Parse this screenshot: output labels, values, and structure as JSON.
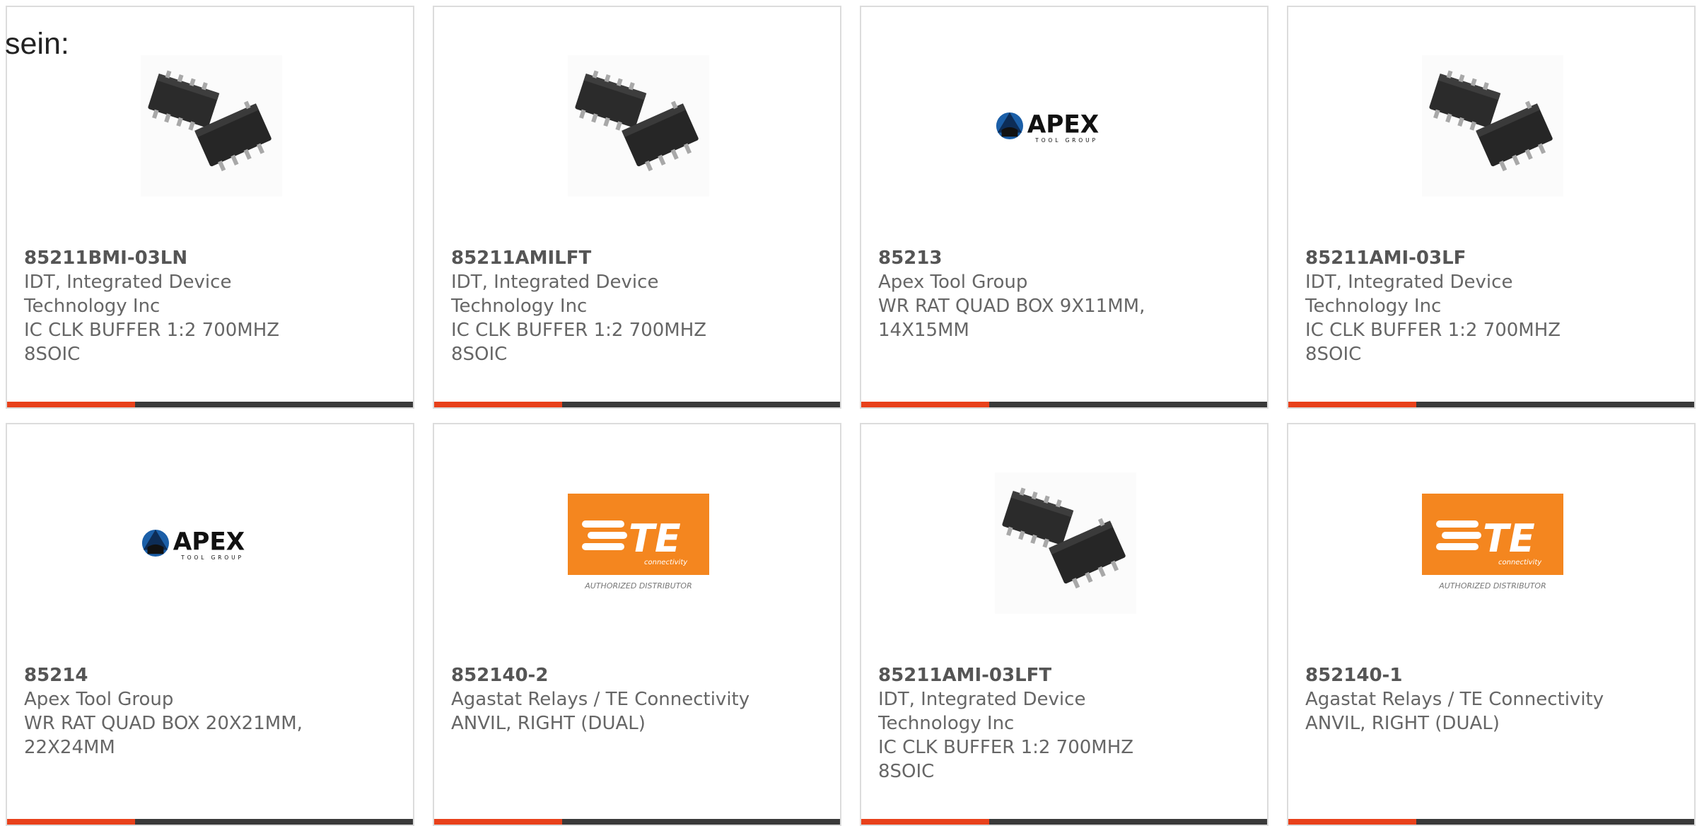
{
  "page_label": "sein:",
  "accent_color": "#e8411b",
  "products": [
    {
      "part_number": "85211BMI-03LN",
      "manufacturer": "IDT, Integrated Device Technology Inc",
      "description": "IC CLK BUFFER 1:2 700MHZ 8SOIC",
      "image": "chip-image"
    },
    {
      "part_number": "85211AMILFT",
      "manufacturer": "IDT, Integrated Device Technology Inc",
      "description": "IC CLK BUFFER 1:2 700MHZ 8SOIC",
      "image": "chip-image"
    },
    {
      "part_number": "85213",
      "manufacturer": "Apex Tool Group",
      "description": "WR RAT QUAD BOX 9X11MM, 14X15MM",
      "image": "apex-logo",
      "logo_text": "APEX",
      "logo_subtext": "TOOL GROUP"
    },
    {
      "part_number": "85211AMI-03LF",
      "manufacturer": "IDT, Integrated Device Technology Inc",
      "description": "IC CLK BUFFER 1:2 700MHZ 8SOIC",
      "image": "chip-image"
    },
    {
      "part_number": "85214",
      "manufacturer": "Apex Tool Group",
      "description": "WR RAT QUAD BOX 20X21MM, 22X24MM",
      "image": "apex-logo",
      "logo_text": "APEX",
      "logo_subtext": "TOOL GROUP"
    },
    {
      "part_number": "852140-2",
      "manufacturer": "Agastat Relays / TE Connectivity",
      "description": "ANVIL, RIGHT (DUAL)",
      "image": "te-logo",
      "logo_text": "TE",
      "logo_subtext": "connectivity",
      "logo_caption": "AUTHORIZED DISTRIBUTOR"
    },
    {
      "part_number": "85211AMI-03LFT",
      "manufacturer": "IDT, Integrated Device Technology Inc",
      "description": "IC CLK BUFFER 1:2 700MHZ 8SOIC",
      "image": "chip-image"
    },
    {
      "part_number": "852140-1",
      "manufacturer": "Agastat Relays / TE Connectivity",
      "description": "ANVIL, RIGHT (DUAL)",
      "image": "te-logo",
      "logo_text": "TE",
      "logo_subtext": "connectivity",
      "logo_caption": "AUTHORIZED DISTRIBUTOR"
    }
  ]
}
